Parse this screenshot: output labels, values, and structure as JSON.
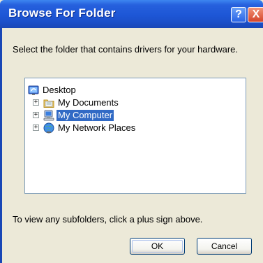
{
  "window": {
    "title": "Browse For Folder",
    "help_glyph": "?",
    "close_glyph": "X"
  },
  "instruction": "Select the folder that contains drivers for your hardware.",
  "tree": {
    "items": [
      {
        "label": "Desktop",
        "icon": "desktop-icon",
        "expander": "",
        "selected": false
      },
      {
        "label": "My Documents",
        "icon": "folder-icon",
        "expander": "+",
        "selected": false
      },
      {
        "label": "My Computer",
        "icon": "computer-icon",
        "expander": "+",
        "selected": true
      },
      {
        "label": "My Network Places",
        "icon": "network-places-icon",
        "expander": "+",
        "selected": false
      }
    ]
  },
  "hint": "To view any subfolders, click a plus sign above.",
  "buttons": {
    "ok": "OK",
    "cancel": "Cancel"
  },
  "colors": {
    "titlebar": "#1d56d6",
    "selection": "#316ac5",
    "dialog_bg": "#ece9d8"
  }
}
